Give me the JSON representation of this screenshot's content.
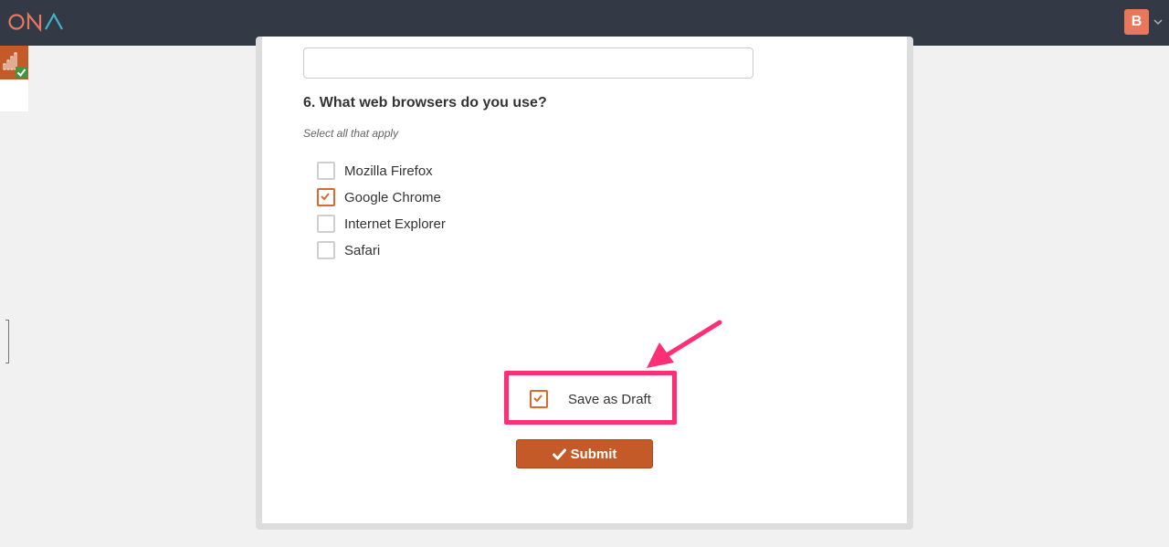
{
  "header": {
    "logo_text": "ONA",
    "user_initial": "B",
    "colors": {
      "bar": "#333a46",
      "logo_orange": "#e8775c",
      "logo_teal": "#3fb5c9",
      "avatar": "#e8775c"
    }
  },
  "sidebar": {
    "widget_icon": "bar-chart-check-icon"
  },
  "form": {
    "question": "6. What web browsers do you use?",
    "hint": "Select all that apply",
    "options": [
      {
        "label": "Mozilla Firefox",
        "checked": false
      },
      {
        "label": "Google Chrome",
        "checked": true
      },
      {
        "label": "Internet Explorer",
        "checked": false
      },
      {
        "label": "Safari",
        "checked": false
      }
    ],
    "save_draft_label": "Save as Draft",
    "save_draft_checked": true,
    "submit_label": "Submit",
    "accent_color": "#c45a28",
    "highlight_color": "#ff2f75"
  }
}
